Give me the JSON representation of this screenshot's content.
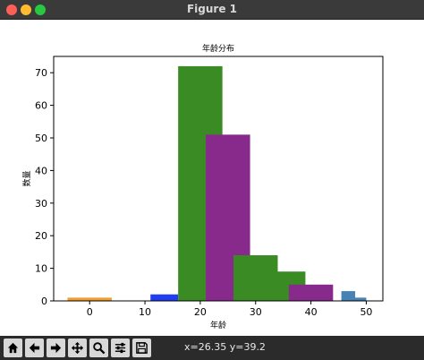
{
  "window": {
    "title": "Figure 1"
  },
  "colors": {
    "orange": "#f0a030",
    "blue": "#1f3ff0",
    "green": "#3a8b23",
    "purple": "#882a8c",
    "steelblue": "#4682b4"
  },
  "chart_data": {
    "type": "bar",
    "title": "年龄分布",
    "xlabel": "年龄",
    "ylabel": "数量",
    "xlim": [
      -6.5,
      53
    ],
    "ylim": [
      0,
      75
    ],
    "xticks": [
      0,
      10,
      20,
      30,
      40,
      50
    ],
    "yticks": [
      0,
      10,
      20,
      30,
      40,
      50,
      60,
      70
    ],
    "grid": false,
    "bars": [
      {
        "x": -4,
        "width": 8,
        "value": 1,
        "color": "orange"
      },
      {
        "x": 11,
        "width": 5,
        "value": 2,
        "color": "blue"
      },
      {
        "x": 16,
        "width": 8,
        "value": 72,
        "color": "green"
      },
      {
        "x": 21,
        "width": 8,
        "value": 51,
        "color": "purple"
      },
      {
        "x": 26,
        "width": 8,
        "value": 14,
        "color": "green"
      },
      {
        "x": 34,
        "width": 5,
        "value": 9,
        "color": "green"
      },
      {
        "x": 36,
        "width": 8,
        "value": 5,
        "color": "purple"
      },
      {
        "x": 45.5,
        "width": 2.5,
        "value": 3,
        "color": "steelblue"
      },
      {
        "x": 47,
        "width": 3,
        "value": 1,
        "color": "steelblue"
      }
    ]
  },
  "toolbar": {
    "icons": [
      "home-icon",
      "back-arrow-icon",
      "forward-arrow-icon",
      "pan-move-icon",
      "zoom-magnifier-icon",
      "configure-subplots-icon",
      "save-disk-icon"
    ],
    "coordinates": "x=26.35 y=39.2"
  }
}
